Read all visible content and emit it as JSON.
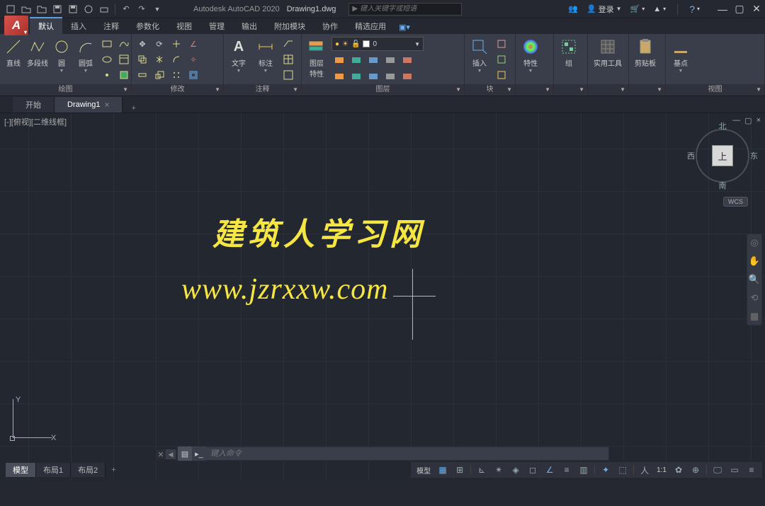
{
  "app": {
    "name": "Autodesk AutoCAD 2020",
    "file": "Drawing1.dwg",
    "logo": "A"
  },
  "search": {
    "placeholder": "键入关键字或短语"
  },
  "title_right": {
    "login": "登录"
  },
  "menu_tabs": [
    "默认",
    "插入",
    "注释",
    "参数化",
    "视图",
    "管理",
    "输出",
    "附加模块",
    "协作",
    "精选应用"
  ],
  "ribbon": {
    "draw": {
      "title": "绘图",
      "line": "直线",
      "polyline": "多段线",
      "circle": "圆",
      "arc": "圆弧"
    },
    "modify": {
      "title": "修改"
    },
    "annotate": {
      "title": "注释",
      "text": "文字",
      "dim": "标注"
    },
    "layers": {
      "title": "图层",
      "props": "图层\n特性",
      "current": "0"
    },
    "block": {
      "title": "块",
      "insert": "插入"
    },
    "properties": {
      "title": "特性"
    },
    "group": {
      "title": "组"
    },
    "utils": {
      "title": "实用工具"
    },
    "clipboard": {
      "title": "剪贴板"
    },
    "view": {
      "title": "视图",
      "base": "基点"
    }
  },
  "file_tabs": {
    "start": "开始",
    "drawing": "Drawing1"
  },
  "viewport": {
    "label": "[-][俯视][二维线框]",
    "viewcube": {
      "top": "上",
      "north": "北",
      "south": "南",
      "east": "东",
      "west": "西"
    },
    "wcs": "WCS",
    "ucs": {
      "x": "X",
      "y": "Y"
    }
  },
  "watermark": {
    "line1": "建筑人学习网",
    "line2": "www.jzrxxw.com"
  },
  "command": {
    "placeholder": "键入命令"
  },
  "layout_tabs": [
    "模型",
    "布局1",
    "布局2"
  ],
  "status": {
    "model": "模型",
    "scale": "1:1"
  }
}
